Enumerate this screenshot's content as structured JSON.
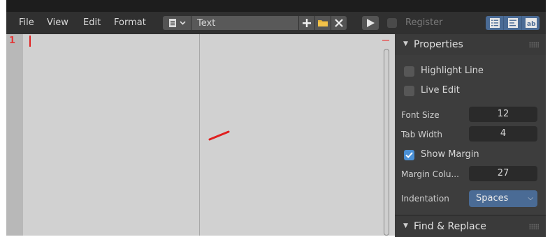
{
  "menu": {
    "file": "File",
    "view": "View",
    "edit": "Edit",
    "format": "Format"
  },
  "header": {
    "text_name": "Text",
    "register_label": "Register",
    "icons": [
      "document-icon",
      "chevron-down-icon",
      "plus-icon",
      "folder-icon",
      "close-icon",
      "play-icon"
    ],
    "view_toggles": [
      "line-numbers-icon",
      "word-wrap-icon",
      "syntax-highlight-icon"
    ]
  },
  "editor": {
    "line_numbers": [
      "1"
    ]
  },
  "sidebar": {
    "properties": {
      "title": "Properties",
      "highlight_line": {
        "label": "Highlight Line",
        "checked": false
      },
      "live_edit": {
        "label": "Live Edit",
        "checked": false
      },
      "font_size": {
        "label": "Font Size",
        "value": "12"
      },
      "tab_width": {
        "label": "Tab Width",
        "value": "4"
      },
      "show_margin": {
        "label": "Show Margin",
        "checked": true
      },
      "margin_column": {
        "label": "Margin Colu...",
        "value": "27"
      },
      "indentation": {
        "label": "Indentation",
        "value": "Spaces"
      }
    },
    "find_replace": {
      "title": "Find & Replace"
    }
  },
  "colors": {
    "accent": "#4a6b95",
    "checkbox_on": "#4a90d6",
    "editor_bg": "#d1d1d1",
    "cursor": "#e02020"
  }
}
